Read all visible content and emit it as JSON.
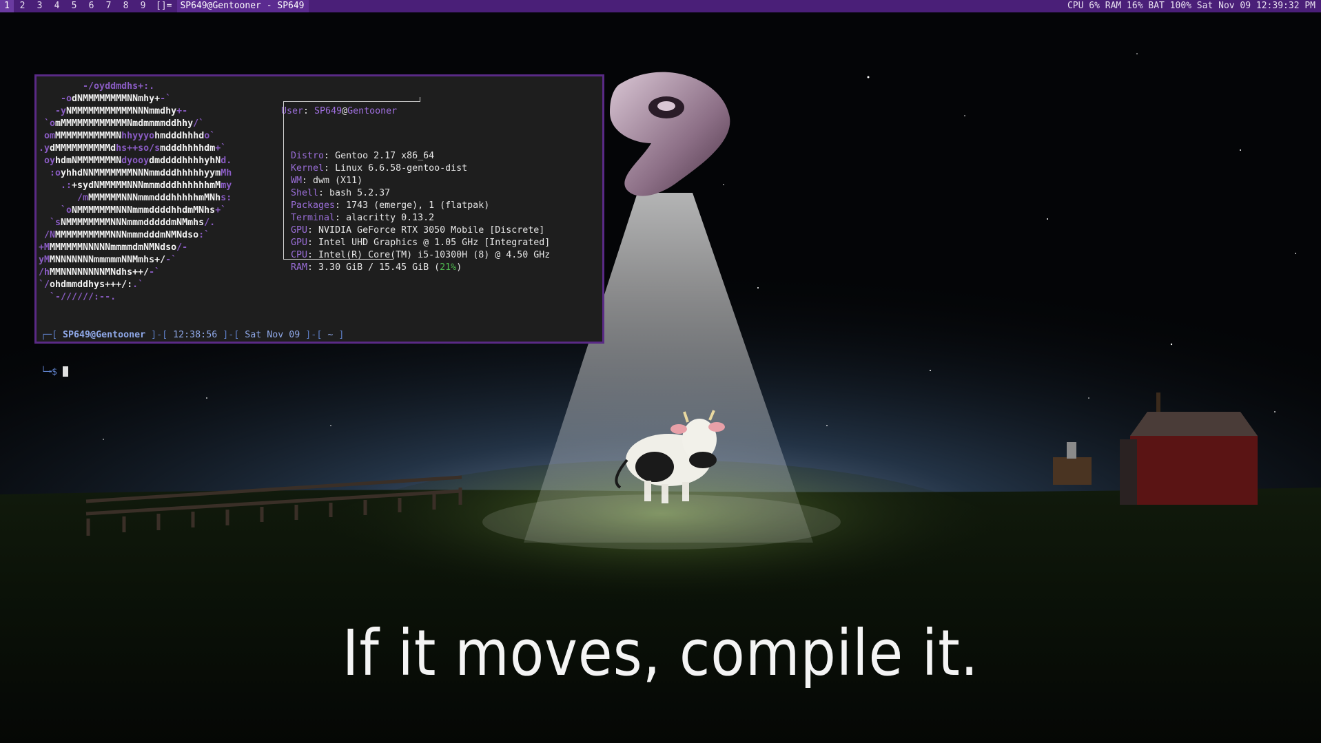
{
  "bar": {
    "tags": [
      "1",
      "2",
      "3",
      "4",
      "5",
      "6",
      "7",
      "8",
      "9"
    ],
    "active_tag": "1",
    "layout_symbol": "[]=",
    "window_title": "SP649@Gentooner - SP649",
    "status": "CPU 6% RAM 16% BAT 100% Sat Nov 09 12:39:32 PM"
  },
  "wallpaper": {
    "tagline": "If it moves, compile it.",
    "icons": [
      "gentoo-logo-icon",
      "ufo-beam",
      "cow-icon",
      "fence",
      "barn",
      "windmill"
    ]
  },
  "terminal": {
    "logo_lines": [
      [
        [
          "p",
          "        -/oyddmdhs+:."
        ]
      ],
      [
        [
          "p",
          "    -o"
        ],
        [
          "w",
          "dNMMMMMMMMNNmhy+"
        ],
        [
          "p",
          "-`"
        ]
      ],
      [
        [
          "p",
          "   -y"
        ],
        [
          "w",
          "NMMMMMMMMMMMNNNmmdhy"
        ],
        [
          "p",
          "+-"
        ]
      ],
      [
        [
          "p",
          " `o"
        ],
        [
          "w",
          "mMMMMMMMMMMMMNmdmmmmddhhy"
        ],
        [
          "p",
          "/`"
        ]
      ],
      [
        [
          "p",
          " om"
        ],
        [
          "w",
          "MMMMMMMMMMMN"
        ],
        [
          "p",
          "hhyyyo"
        ],
        [
          "w",
          "hmdddhhhd"
        ],
        [
          "p",
          "o`"
        ]
      ],
      [
        [
          "p",
          ".y"
        ],
        [
          "w",
          "dMMMMMMMMMMd"
        ],
        [
          "p",
          "hs++so/s"
        ],
        [
          "w",
          "mdddhhhhdm"
        ],
        [
          "p",
          "+`"
        ]
      ],
      [
        [
          "p",
          " oy"
        ],
        [
          "w",
          "hdmNMMMMMMMN"
        ],
        [
          "p",
          "dyooy"
        ],
        [
          "w",
          "dmddddhhhhyhN"
        ],
        [
          "p",
          "d."
        ]
      ],
      [
        [
          "p",
          "  :o"
        ],
        [
          "w",
          "yhhdNNMMMMMMMNNNmmdddhhhhhyym"
        ],
        [
          "p",
          "Mh"
        ]
      ],
      [
        [
          "p",
          "    .:"
        ],
        [
          "w",
          "+sydNMMMMMNNNmmmdddhhhhhhmM"
        ],
        [
          "p",
          "my"
        ]
      ],
      [
        [
          "p",
          "       /m"
        ],
        [
          "w",
          "MMMMMMNNNmmmdddhhhhhmMNh"
        ],
        [
          "p",
          "s:"
        ]
      ],
      [
        [
          "p",
          "    `o"
        ],
        [
          "w",
          "NMMMMMMMNNNmmmddddhhdmMNhs"
        ],
        [
          "p",
          "+`"
        ]
      ],
      [
        [
          "p",
          "  `s"
        ],
        [
          "w",
          "NMMMMMMMMNNNmmmdddddmNMmhs"
        ],
        [
          "p",
          "/."
        ]
      ],
      [
        [
          "p",
          " /N"
        ],
        [
          "w",
          "MMMMMMMMMMNNNmmmdddmNMNdso"
        ],
        [
          "p",
          ":`"
        ]
      ],
      [
        [
          "p",
          "+M"
        ],
        [
          "w",
          "MMMMMMNNNNNmmmmdmNMNdso"
        ],
        [
          "p",
          "/-"
        ]
      ],
      [
        [
          "p",
          "yM"
        ],
        [
          "w",
          "MNNNNNNNmmmmmNNMmhs+/"
        ],
        [
          "p",
          "-`"
        ]
      ],
      [
        [
          "p",
          "/h"
        ],
        [
          "w",
          "MMNNNNNNNNMNdhs++/"
        ],
        [
          "p",
          "-`"
        ]
      ],
      [
        [
          "p",
          "`/"
        ],
        [
          "w",
          "ohdmmddhys+++/:"
        ],
        [
          "p",
          ".`"
        ]
      ],
      [
        [
          "p",
          "  `-//////:--."
        ]
      ]
    ],
    "user_label": "User",
    "user": "SP649",
    "at": "@",
    "host": "Gentooner",
    "info": [
      {
        "key": "Distro",
        "value": "Gentoo 2.17 x86_64"
      },
      {
        "key": "Kernel",
        "value": "Linux 6.6.58-gentoo-dist"
      },
      {
        "key": "WM",
        "value": "dwm (X11)"
      },
      {
        "key": "Shell",
        "value": "bash 5.2.37"
      },
      {
        "key": "Packages",
        "value": "1743 (emerge), 1 (flatpak)"
      },
      {
        "key": "Terminal",
        "value": "alacritty 0.13.2"
      },
      {
        "key": "GPU",
        "value": "NVIDIA GeForce RTX 3050 Mobile [Discrete]"
      },
      {
        "key": "GPU",
        "value": "Intel UHD Graphics @ 1.05 GHz [Integrated]"
      },
      {
        "key": "CPU",
        "value": "Intel(R) Core(TM) i5-10300H (8) @ 4.50 GHz"
      },
      {
        "key": "RAM",
        "value": "3.30 GiB / 15.45 GiB (",
        "percent": "21%",
        "tail": ")"
      }
    ],
    "prompt": {
      "open": "┌─[ ",
      "user_host": "SP649@Gentooner",
      "sep1": " ]-[ ",
      "time": "12:38:56",
      "sep2": " ]-[ ",
      "date": "Sat Nov 09",
      "sep3": " ]-[ ",
      "dir": "~",
      "close": " ]",
      "line2": "└╼$ "
    }
  },
  "colors": {
    "bar_bg": "#4a1f78",
    "accent_purple": "#8a5cc4",
    "terminal_bg": "#1e1e1e",
    "terminal_border": "#5a2a86",
    "ram_percent": "#4fb84f"
  }
}
